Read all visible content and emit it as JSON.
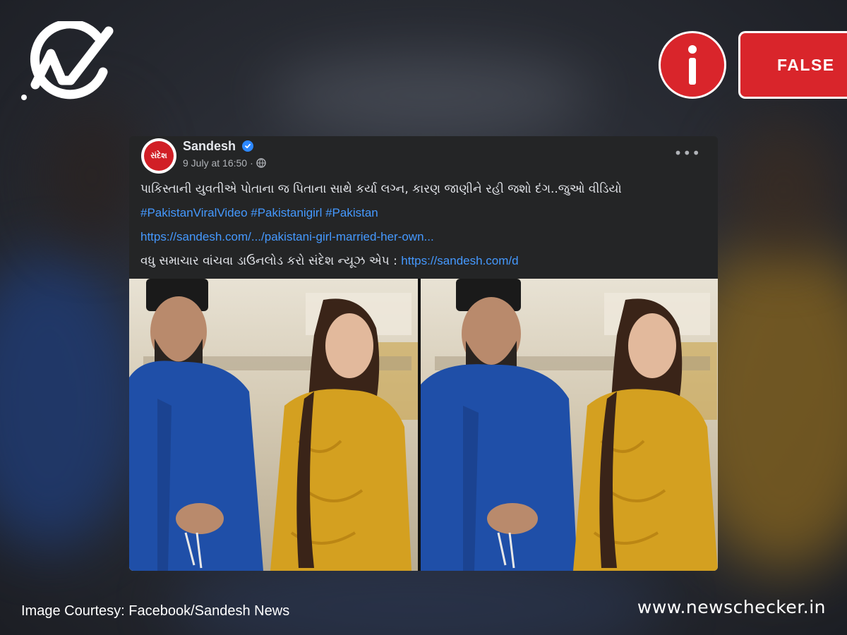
{
  "brand": {
    "logo_icon": "newschecker-check-logo-icon",
    "site_url": "www.newschecker.in",
    "image_courtesy": "Image Courtesy: Facebook/Sandesh News"
  },
  "verdict": {
    "icon": "info-icon",
    "label": "FALSE",
    "color": "#d9252b"
  },
  "post": {
    "page_name": "Sandesh",
    "avatar_text": "સંદેશ",
    "verified_icon": "verified-badge-icon",
    "timestamp": "9 July at 16:50",
    "separator": "·",
    "audience_icon": "globe-icon",
    "more_icon": "more-options-icon",
    "more_symbol": "•••",
    "headline": "પાકિસ્તાની યુવતીએ પોતાના જ પિતાના સાથે કર્યા લગ્ન, કારણ જાણીને રહી જશો દંગ..જુઓ વીડિયો",
    "hashtags": "#PakistanViralVideo #Pakistanigirl #Pakistan",
    "article_link": "https://sandesh.com/.../pakistani-girl-married-her-own...",
    "app_prompt": "વધુ સમાચાર વાંચવા ડાઉનલોડ કરો સંદેશ ન્યૂઝ એપ : ",
    "app_link": "https://sandesh.com/d"
  },
  "colors": {
    "card_bg": "#242526",
    "link": "#4599ff",
    "text": "#e4e6eb",
    "muted": "#b0b3b8",
    "kurta_blue": "#1f4fa8",
    "kurti_yellow": "#d4a020"
  }
}
